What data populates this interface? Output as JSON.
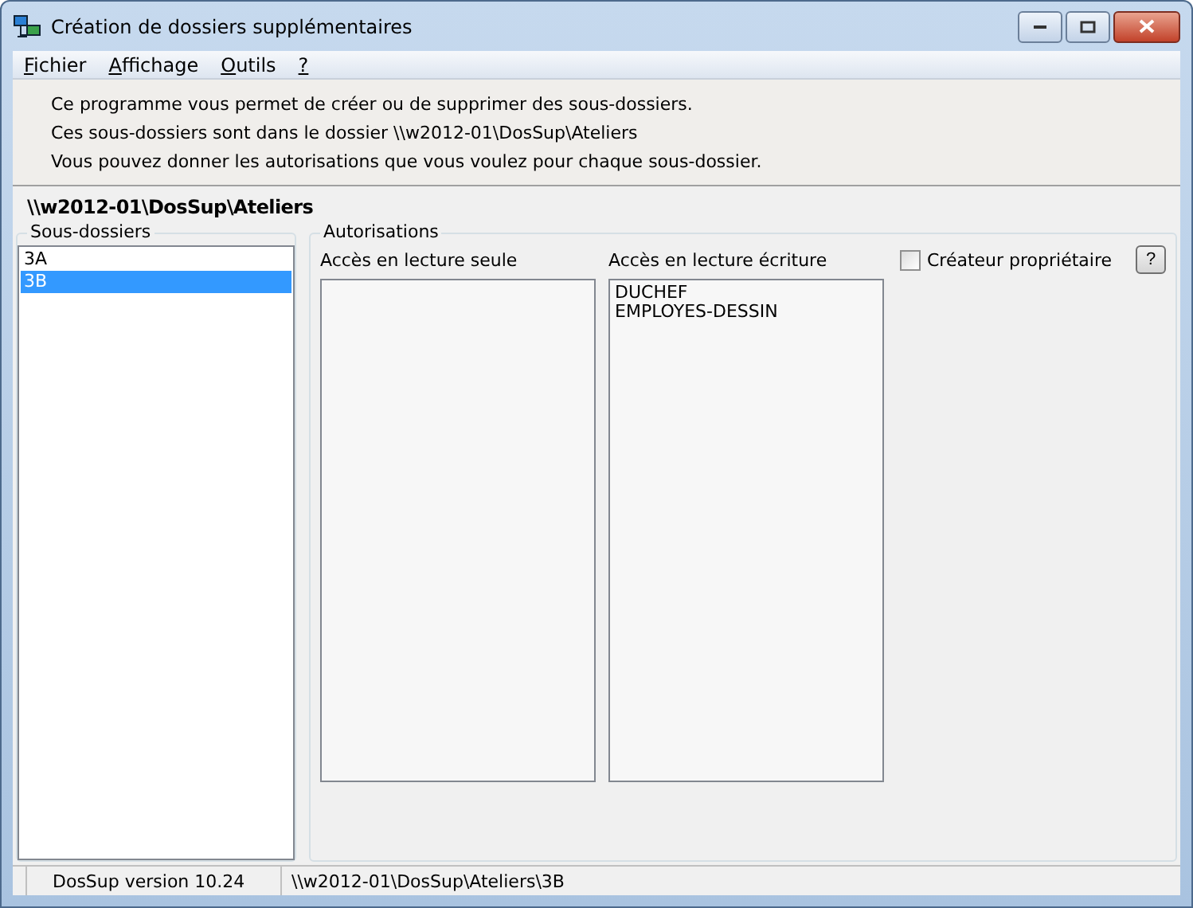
{
  "window": {
    "title": "Création de dossiers supplémentaires"
  },
  "menu": [
    "Fichier",
    "Affichage",
    "Outils",
    "?"
  ],
  "intro": [
    "Ce programme vous permet de créer ou de supprimer des sous-dossiers.",
    "Ces sous-dossiers sont dans le dossier \\\\w2012-01\\DosSup\\Ateliers",
    "Vous pouvez donner les autorisations que vous voulez pour chaque sous-dossier."
  ],
  "path": "\\\\w2012-01\\DosSup\\Ateliers",
  "subfolders": {
    "title": "Sous-dossiers",
    "items": [
      {
        "label": "3A",
        "selected": false
      },
      {
        "label": "3B",
        "selected": true
      }
    ]
  },
  "permissions": {
    "title": "Autorisations",
    "read_only": {
      "label": "Accès en lecture seule"
    },
    "read_write": {
      "label": "Accès en lecture écriture",
      "items": [
        "DUCHEF",
        "EMPLOYES-DESSIN"
      ]
    },
    "owner_checkbox": {
      "label": "Créateur propriétaire",
      "checked": false
    },
    "help_button": "?"
  },
  "status_bar": [
    "DosSup version 10.24",
    "\\\\w2012-01\\DosSup\\Ateliers\\3B"
  ]
}
